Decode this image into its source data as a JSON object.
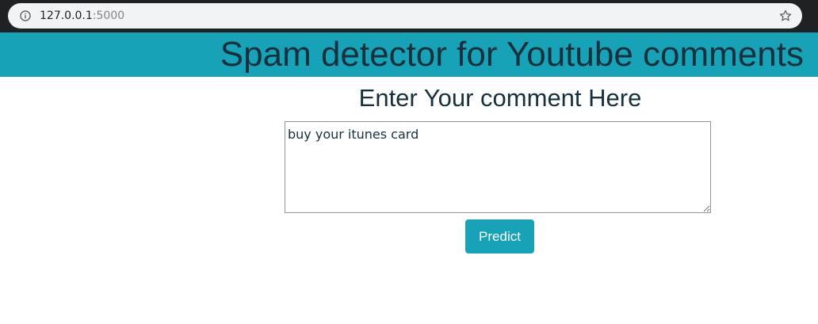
{
  "browser": {
    "url_host": "127.0.0.1",
    "url_port": ":5000"
  },
  "header": {
    "title": "Spam detector for Youtube comments"
  },
  "form": {
    "heading": "Enter Your comment Here",
    "comment_value": "buy your itunes card",
    "predict_label": "Predict"
  },
  "colors": {
    "accent": "#17a2b8",
    "heading_text": "#17303d"
  },
  "icons": {
    "site_info": "info-icon",
    "bookmark": "star-icon"
  }
}
